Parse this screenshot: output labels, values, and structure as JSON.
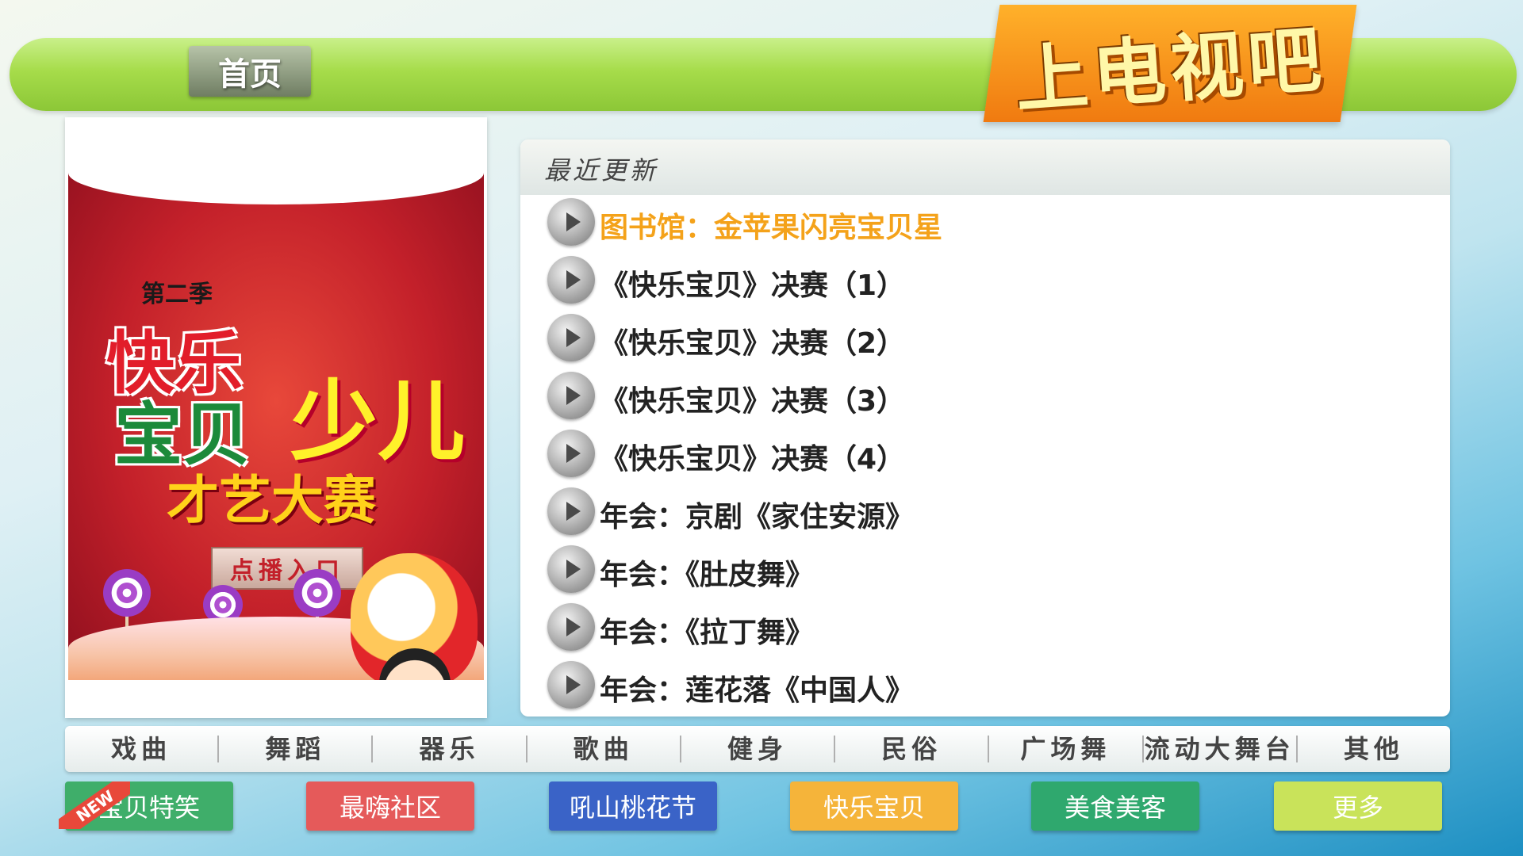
{
  "header": {
    "home_label": "首页",
    "logo_text": "上电视吧"
  },
  "poster": {
    "season": "第二季",
    "title_line1": "快乐",
    "title_line2": "宝贝",
    "title_big": "少儿",
    "subtitle": "才艺大赛",
    "entry_button": "点播入口"
  },
  "recent": {
    "title": "最近更新",
    "items": [
      {
        "label": "图书馆：金苹果闪亮宝贝星"
      },
      {
        "label": "《快乐宝贝》决赛（1）"
      },
      {
        "label": "《快乐宝贝》决赛（2）"
      },
      {
        "label": "《快乐宝贝》决赛（3）"
      },
      {
        "label": "《快乐宝贝》决赛（4）"
      },
      {
        "label": "年会：京剧《家住安源》"
      },
      {
        "label": "年会：《肚皮舞》"
      },
      {
        "label": "年会：《拉丁舞》"
      },
      {
        "label": "年会：莲花落《中国人》"
      }
    ],
    "active_index": 0,
    "active_color": "#f4a21a"
  },
  "categories": [
    "戏曲",
    "舞蹈",
    "器乐",
    "歌曲",
    "健身",
    "民俗",
    "广场舞",
    "流动大舞台",
    "其他"
  ],
  "buttons": [
    {
      "label": "宝贝特笑",
      "color": "#3fae6a",
      "badge": "NEW"
    },
    {
      "label": "最嗨社区",
      "color": "#e55a5a"
    },
    {
      "label": "吼山桃花节",
      "color": "#3a63c7"
    },
    {
      "label": "快乐宝贝",
      "color": "#f5b43a"
    },
    {
      "label": "美食美客",
      "color": "#2fa86e"
    },
    {
      "label": "更多",
      "color": "#c9e35a"
    }
  ]
}
